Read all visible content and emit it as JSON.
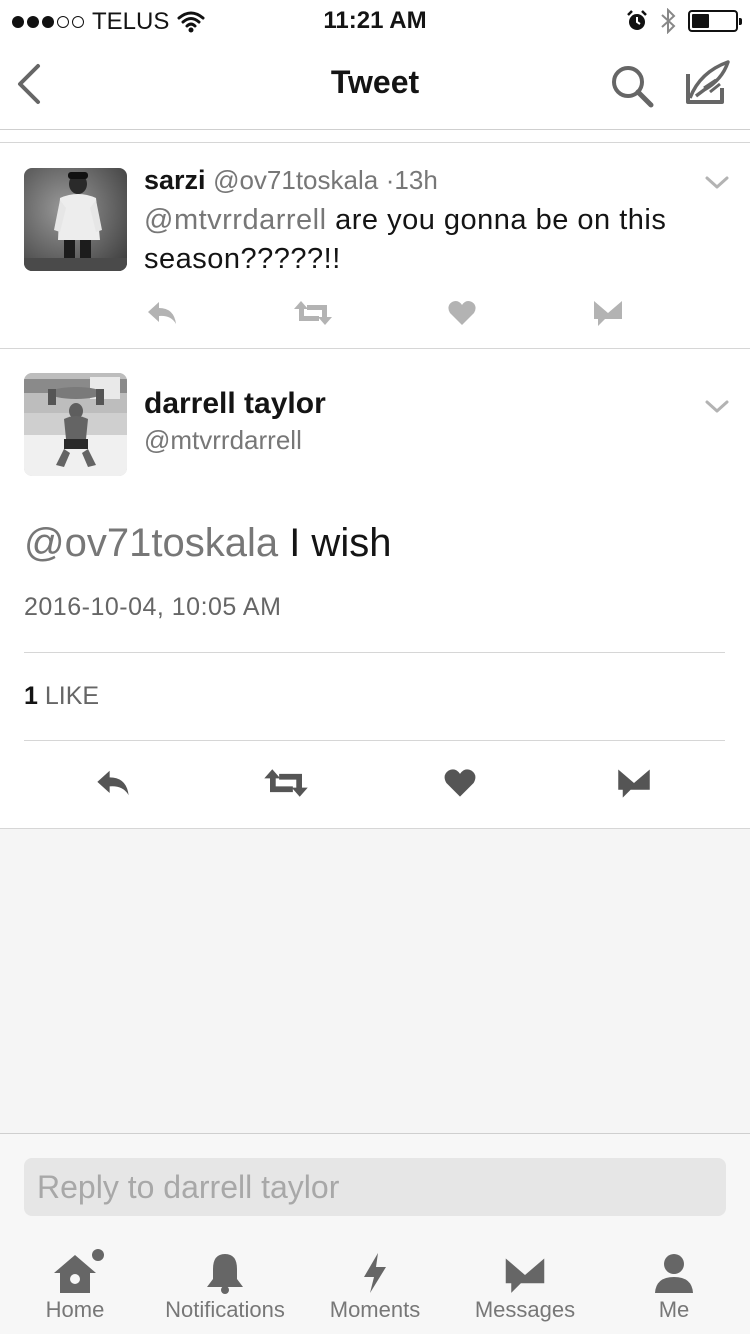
{
  "status_bar": {
    "carrier": "TELUS",
    "time": "11:21 AM",
    "signal_bars_filled": 3,
    "signal_bars_total": 5,
    "battery_level": 0.4,
    "icons": [
      "wifi-icon",
      "alarm-icon",
      "bluetooth-icon",
      "battery-icon"
    ]
  },
  "nav": {
    "title": "Tweet",
    "icons": [
      "back-chevron-icon",
      "search-icon",
      "compose-tweet-icon"
    ]
  },
  "parent_tweet": {
    "display_name": "sarzi",
    "handle": "@ov71toskala",
    "separator": "·",
    "age": "13h",
    "mention": "@mtvrrdarrell",
    "text": " are you gonna be on this season?????!!",
    "actions": [
      "reply-icon",
      "retweet-icon",
      "like-icon",
      "direct-message-icon"
    ]
  },
  "focused_tweet": {
    "display_name": "darrell taylor",
    "handle": "@mtvrrdarrell",
    "mention": "@ov71toskala",
    "text": " I wish",
    "timestamp": "2016-10-04, 10:05 AM",
    "like_count": "1",
    "like_label": " LIKE",
    "actions": [
      "reply-icon",
      "retweet-icon",
      "like-icon",
      "direct-message-icon"
    ]
  },
  "reply": {
    "placeholder": "Reply to darrell taylor"
  },
  "tabbar": {
    "tabs": [
      {
        "label": "Home",
        "icon": "home-icon"
      },
      {
        "label": "Notifications",
        "icon": "bell-icon"
      },
      {
        "label": "Moments",
        "icon": "lightning-icon"
      },
      {
        "label": "Messages",
        "icon": "envelope-icon"
      },
      {
        "label": "Me",
        "icon": "person-icon"
      }
    ]
  },
  "colors": {
    "text": "#141414",
    "muted": "#777777",
    "icon_light": "#b3b3b3",
    "icon_dark": "#555555",
    "empty_bg": "#f5f5f5"
  }
}
